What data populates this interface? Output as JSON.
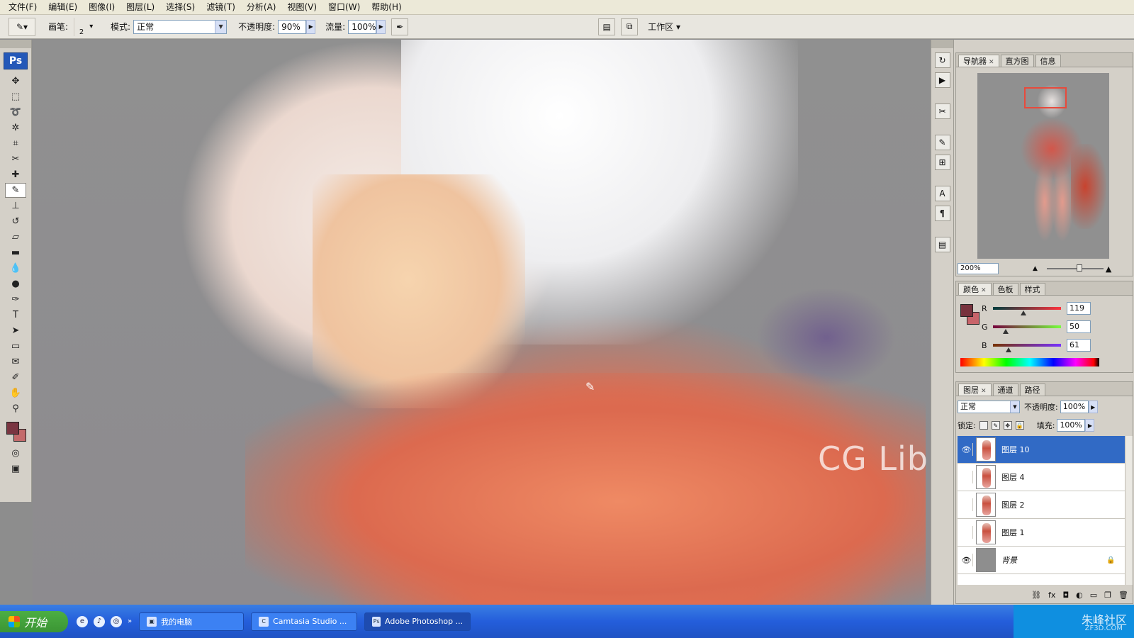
{
  "menu": [
    "文件(F)",
    "编辑(E)",
    "图像(I)",
    "图层(L)",
    "选择(S)",
    "滤镜(T)",
    "分析(A)",
    "视图(V)",
    "窗口(W)",
    "帮助(H)"
  ],
  "options": {
    "brush_label": "画笔:",
    "brush_size": "2",
    "mode_label": "模式:",
    "mode_value": "正常",
    "opacity_label": "不透明度:",
    "opacity_value": "90%",
    "flow_label": "流量:",
    "flow_value": "100%",
    "workspace_label": "工作区"
  },
  "toolbox": {
    "logo": "Ps",
    "tools": [
      "move-tool",
      "marquee-tool",
      "lasso-tool",
      "magic-wand-tool",
      "crop-tool",
      "slice-tool",
      "healing-brush-tool",
      "brush-tool",
      "clone-stamp-tool",
      "history-brush-tool",
      "eraser-tool",
      "gradient-tool",
      "blur-tool",
      "dodge-tool",
      "pen-tool",
      "type-tool",
      "path-selection-tool",
      "shape-tool",
      "notes-tool",
      "eyedropper-tool",
      "hand-tool",
      "zoom-tool"
    ],
    "active_tool": "brush-tool",
    "foreground_color": "#7a3541",
    "background_color": "#c46a6b"
  },
  "canvas": {
    "watermark": "CG Library"
  },
  "navigator": {
    "tabs": [
      "导航器",
      "直方图",
      "信息"
    ],
    "zoom": "200%"
  },
  "color_panel": {
    "tabs": [
      "颜色",
      "色板",
      "样式"
    ],
    "r_label": "R",
    "g_label": "G",
    "b_label": "B",
    "r": "119",
    "g": "50",
    "b": "61",
    "r_level": 0.47,
    "g_level": 0.2,
    "b_level": 0.24
  },
  "layers_panel": {
    "tabs": [
      "图层",
      "通道",
      "路径"
    ],
    "blend_mode": "正常",
    "opacity_label": "不透明度:",
    "opacity_value": "100%",
    "lock_label": "锁定:",
    "fill_label": "填充:",
    "fill_value": "100%",
    "layers": [
      {
        "name": "图层 10",
        "visible": true,
        "selected": true
      },
      {
        "name": "图层 4",
        "visible": false,
        "selected": false
      },
      {
        "name": "图层 2",
        "visible": false,
        "selected": false
      },
      {
        "name": "图层 1",
        "visible": false,
        "selected": false
      },
      {
        "name": "背景",
        "visible": true,
        "selected": false,
        "locked": true
      }
    ]
  },
  "taskbar": {
    "start": "开始",
    "tasks": [
      "我的电脑",
      "Camtasia Studio ...",
      "Adobe Photoshop ..."
    ],
    "watermark": "朱峰社区",
    "watermark_sub": "ZF3D.COM"
  }
}
